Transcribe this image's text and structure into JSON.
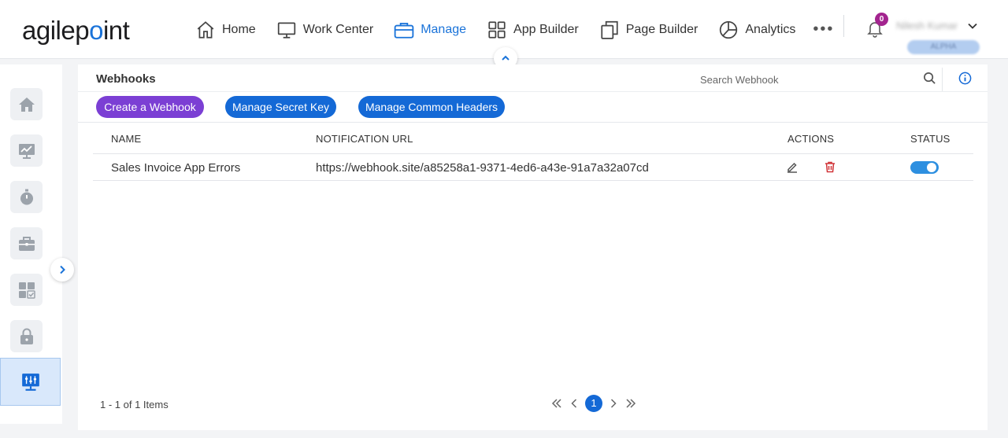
{
  "app": {
    "logo_text_pre": "agilep",
    "logo_text_dot": "o",
    "logo_text_post": "int"
  },
  "nav": {
    "items": [
      {
        "label": "Home",
        "icon": "home-icon"
      },
      {
        "label": "Work Center",
        "icon": "monitor-icon"
      },
      {
        "label": "Manage",
        "icon": "briefcase-icon",
        "active": true
      },
      {
        "label": "App Builder",
        "icon": "grid-icon"
      },
      {
        "label": "Page Builder",
        "icon": "pages-icon"
      },
      {
        "label": "Analytics",
        "icon": "pie-chart-icon"
      }
    ],
    "more": "•••",
    "notification_count": "0",
    "user_name": "Nilesh Kumar",
    "environment": "ALPHA"
  },
  "page": {
    "title": "Webhooks",
    "search_placeholder": "Search Webhook"
  },
  "toolbar": {
    "create_label": "Create a Webhook",
    "secret_label": "Manage Secret Key",
    "headers_label": "Manage Common Headers"
  },
  "table": {
    "headers": {
      "name": "NAME",
      "url": "NOTIFICATION URL",
      "actions": "ACTIONS",
      "status": "STATUS"
    },
    "rows": [
      {
        "name": "Sales Invoice App Errors",
        "url": "https://webhook.site/a85258a1-9371-4ed6-a43e-91a7a32a07cd",
        "status_enabled": true
      }
    ]
  },
  "pager": {
    "info": "1 - 1 of 1 Items",
    "current_page": "1"
  },
  "colors": {
    "primary": "#1469d6",
    "create_button": "#7b3fd4",
    "delete_icon": "#d13438",
    "toggle_on": "#2d8fe0",
    "notification_badge": "#a3248f"
  }
}
